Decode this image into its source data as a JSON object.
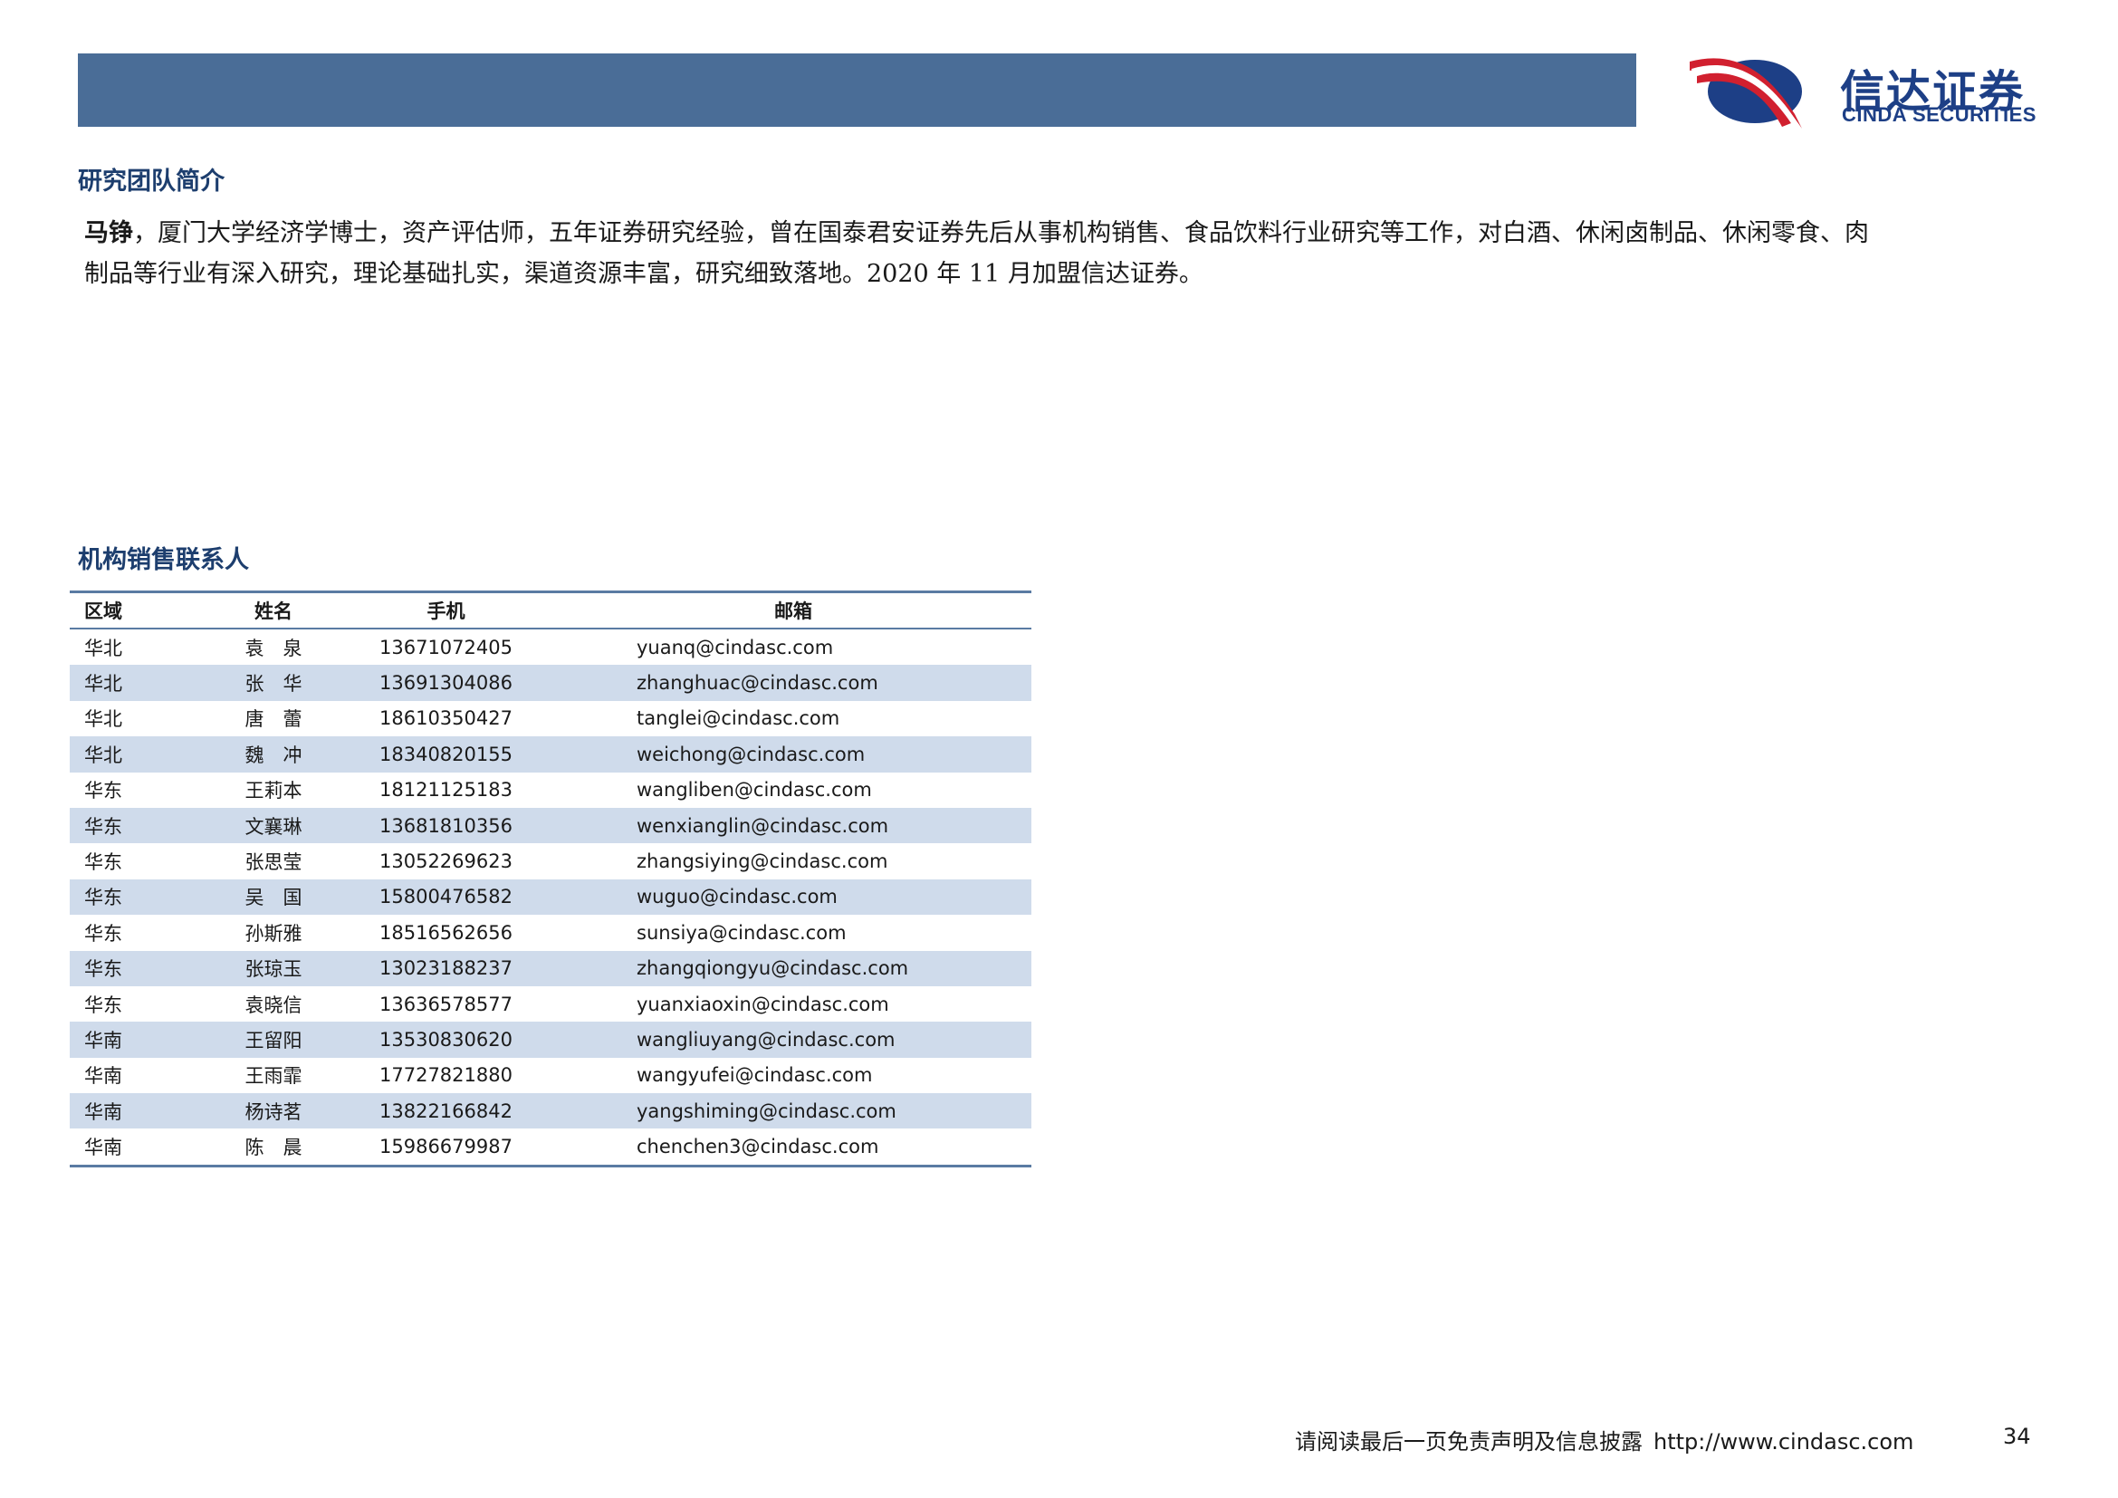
{
  "logo": {
    "cn": "信达证券",
    "en": "CINDA SECURITIES",
    "colors": {
      "red": "#d1202f",
      "blue": "#1d3f86"
    }
  },
  "header": {
    "bar_color": "#4a6d97"
  },
  "team": {
    "title": "研究团队简介",
    "analyst_name": "马铮",
    "bio_line1": "，厦门大学经济学博士，资产评估师，五年证券研究经验，曾在国泰君安证券先后从事机构销售、食品饮料行业研究等工作，对白酒、休闲卤制品、休闲零食、肉",
    "bio_line2": "制品等行业有深入研究，理论基础扎实，渠道资源丰富，研究细致落地。2020 年 11 月加盟信达证券。"
  },
  "sales": {
    "title": "机构销售联系人",
    "headers": {
      "region": "区域",
      "name": "姓名",
      "phone": "手机",
      "email": "邮箱"
    },
    "rows": [
      {
        "region": "华北",
        "name": "袁　泉",
        "phone": "13671072405",
        "email": "yuanq@cindasc.com"
      },
      {
        "region": "华北",
        "name": "张　华",
        "phone": "13691304086",
        "email": "zhanghuac@cindasc.com"
      },
      {
        "region": "华北",
        "name": "唐　蕾",
        "phone": "18610350427",
        "email": "tanglei@cindasc.com"
      },
      {
        "region": "华北",
        "name": "魏　冲",
        "phone": "18340820155",
        "email": "weichong@cindasc.com"
      },
      {
        "region": "华东",
        "name": "王莉本",
        "phone": "18121125183",
        "email": "wangliben@cindasc.com"
      },
      {
        "region": "华东",
        "name": "文襄琳",
        "phone": "13681810356",
        "email": "wenxianglin@cindasc.com"
      },
      {
        "region": "华东",
        "name": "张思莹",
        "phone": "13052269623",
        "email": "zhangsiying@cindasc.com"
      },
      {
        "region": "华东",
        "name": "吴　国",
        "phone": "15800476582",
        "email": "wuguo@cindasc.com"
      },
      {
        "region": "华东",
        "name": "孙斯雅",
        "phone": "18516562656",
        "email": "sunsiya@cindasc.com"
      },
      {
        "region": "华东",
        "name": "张琼玉",
        "phone": "13023188237",
        "email": "zhangqiongyu@cindasc.com"
      },
      {
        "region": "华东",
        "name": "袁晓信",
        "phone": "13636578577",
        "email": "yuanxiaoxin@cindasc.com"
      },
      {
        "region": "华南",
        "name": "王留阳",
        "phone": "13530830620",
        "email": "wangliuyang@cindasc.com"
      },
      {
        "region": "华南",
        "name": "王雨霏",
        "phone": "17727821880",
        "email": "wangyufei@cindasc.com"
      },
      {
        "region": "华南",
        "name": "杨诗茗",
        "phone": "13822166842",
        "email": "yangshiming@cindasc.com"
      },
      {
        "region": "华南",
        "name": "陈　晨",
        "phone": "15986679987",
        "email": "chenchen3@cindasc.com"
      }
    ]
  },
  "footer": {
    "disclaimer": "请阅读最后一页免责声明及信息披露",
    "url": "http://www.cindasc.com",
    "page": "34"
  }
}
